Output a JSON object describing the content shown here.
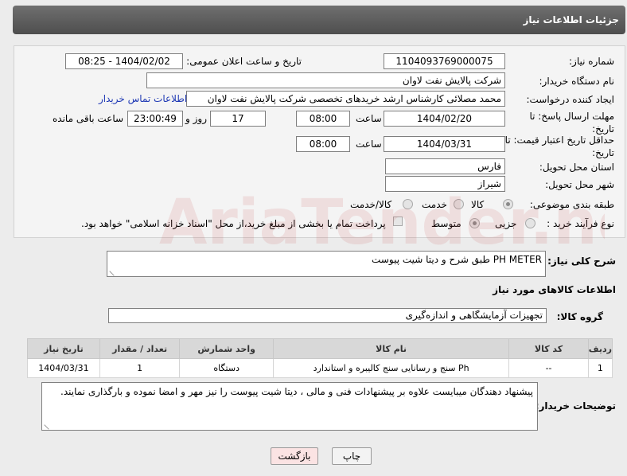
{
  "header": {
    "title": "جزئیات اطلاعات نیاز"
  },
  "form": {
    "need_number": {
      "label": "شماره نیاز:",
      "value": "1104093769000075"
    },
    "announce": {
      "label": "تاریخ و ساعت اعلان عمومی:",
      "value": "1404/02/02 - 08:25"
    },
    "buyer_org": {
      "label": "نام دستگاه خریدار:",
      "value": "شرکت پالایش نفت لاوان"
    },
    "creator": {
      "label": "ایجاد کننده درخواست:",
      "value": "محمد مصلائی کارشناس ارشد خریدهای تخصصی شرکت پالایش نفت لاوان",
      "contact_link": "اطلاعات تماس خریدار"
    },
    "deadline": {
      "label": "مهلت ارسال پاسخ: تا تاریخ:",
      "date": "1404/02/20",
      "time_label": "ساعت",
      "time": "08:00",
      "days": "17",
      "days_label": "روز و",
      "remaining": "23:00:49",
      "remaining_label": "ساعت باقی مانده"
    },
    "price_validity": {
      "label": "حداقل تاریخ اعتبار قیمت: تا تاریخ:",
      "date": "1404/03/31",
      "time_label": "ساعت",
      "time": "08:00"
    },
    "province": {
      "label": "استان محل تحویل:",
      "value": "فارس"
    },
    "city": {
      "label": "شهر محل تحویل:",
      "value": "شیراز"
    },
    "category": {
      "label": "طبقه بندی موضوعی:",
      "options": [
        "کالا",
        "خدمت",
        "کالا/خدمت"
      ],
      "selected": "کالا"
    },
    "process": {
      "label": "نوع فرآیند خرید :",
      "options": [
        "جزیی",
        "متوسط"
      ],
      "selected": "متوسط",
      "payment_note": "پرداخت تمام یا بخشی از مبلغ خرید،از محل \"اسناد خزانه اسلامی\" خواهد بود."
    }
  },
  "description": {
    "label": "شرح کلی نیاز:",
    "value": "PH METER  طبق شرح و دیتا شیت پیوست"
  },
  "goods_section": {
    "title": "اطلاعات کالاهای مورد نیاز",
    "group_label": "گروه کالا:",
    "group_value": "تجهیزات آزمایشگاهی و اندازه‌گیری"
  },
  "table": {
    "headers": [
      "ردیف",
      "کد کالا",
      "نام کالا",
      "واحد شمارش",
      "تعداد / مقدار",
      "تاریخ نیاز"
    ],
    "rows": [
      [
        "1",
        "--",
        "Ph سنج و رسانایی سنج کالیبره و استاندارد",
        "دستگاه",
        "1",
        "1404/03/31"
      ]
    ]
  },
  "buyer_notes": {
    "label": "توضیحات خریدار:",
    "value": "پیشنهاد دهندگان میبایست علاوه بر پیشنهادات فنی و مالی ، دیتا شیت پیوست را نیز مهر و امضا نموده و بارگذاری نمایند."
  },
  "buttons": {
    "print": "چاپ",
    "back": "بازگشت"
  },
  "watermark": "AriaTender.neT",
  "colors": {
    "header_bg": "#5a5a5a",
    "link": "#1f39b5",
    "back_button_bg": "#fbe3e3"
  }
}
